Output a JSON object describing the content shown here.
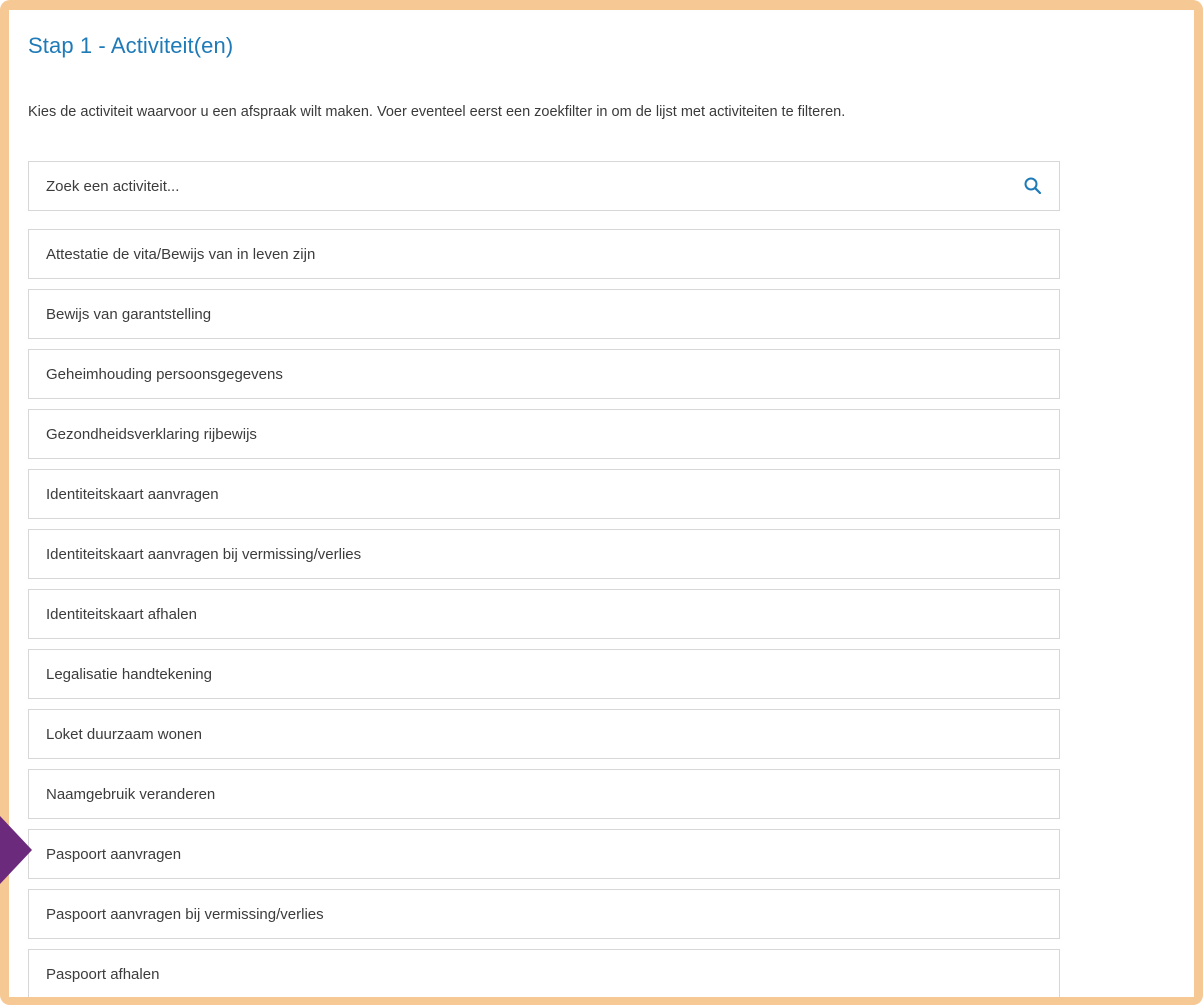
{
  "step": {
    "title": "Stap 1 - Activiteit(en)",
    "instruction": "Kies de activiteit waarvoor u een afspraak wilt maken. Voer eventeel eerst een zoekfilter in om de lijst met activiteiten te filteren."
  },
  "search": {
    "placeholder": "Zoek een activiteit...",
    "value": "",
    "icon": "search-icon"
  },
  "activities": [
    "Attestatie de vita/Bewijs van in leven zijn",
    "Bewijs van garantstelling",
    "Geheimhouding persoonsgegevens",
    "Gezondheidsverklaring rijbewijs",
    "Identiteitskaart aanvragen",
    "Identiteitskaart aanvragen bij vermissing/verlies",
    "Identiteitskaart afhalen",
    "Legalisatie handtekening",
    "Loket duurzaam wonen",
    "Naamgebruik veranderen",
    "Paspoort aanvragen",
    "Paspoort aanvragen bij vermissing/verlies",
    "Paspoort afhalen"
  ],
  "colors": {
    "frame": "#f6c894",
    "title": "#1f7ab8",
    "accent_icon": "#1f7ab8",
    "pointer": "#6b2a7c",
    "border": "#d7d7d7"
  }
}
